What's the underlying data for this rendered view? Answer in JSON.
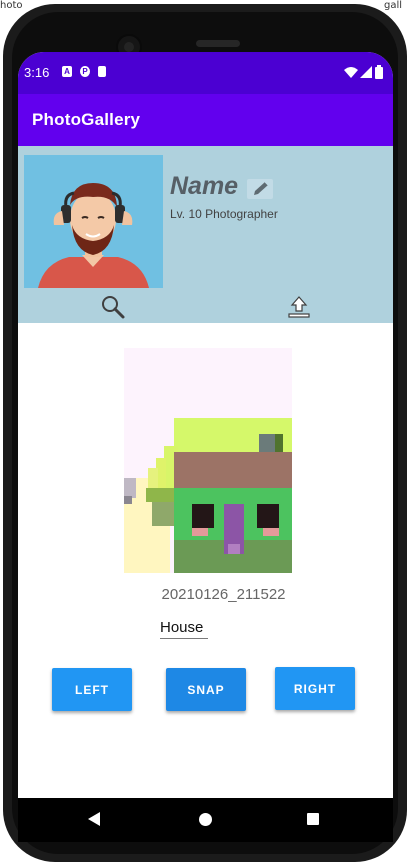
{
  "background": {
    "left_text": "hoto",
    "right_text": "gall"
  },
  "status_bar": {
    "time": "3:16",
    "left_icons": [
      "a-icon",
      "p-icon",
      "sd-card-icon"
    ],
    "right_icons": [
      "wifi-icon",
      "signal-icon",
      "battery-icon"
    ]
  },
  "app_bar": {
    "title": "PhotoGallery"
  },
  "profile": {
    "name": "Name",
    "level": "Lv. 10 Photographer",
    "edit_icon": "pencil-icon",
    "search_icon": "search-icon",
    "upload_icon": "upload-icon"
  },
  "photo": {
    "timestamp": "20210126_211522",
    "caption": "House"
  },
  "buttons": {
    "left": "LEFT",
    "snap": "SNAP",
    "right": "RIGHT"
  },
  "colors": {
    "status_bar": "#4b00d2",
    "app_bar": "#6200ee",
    "profile_bg": "#afd1dd",
    "button": "#2196f3"
  }
}
